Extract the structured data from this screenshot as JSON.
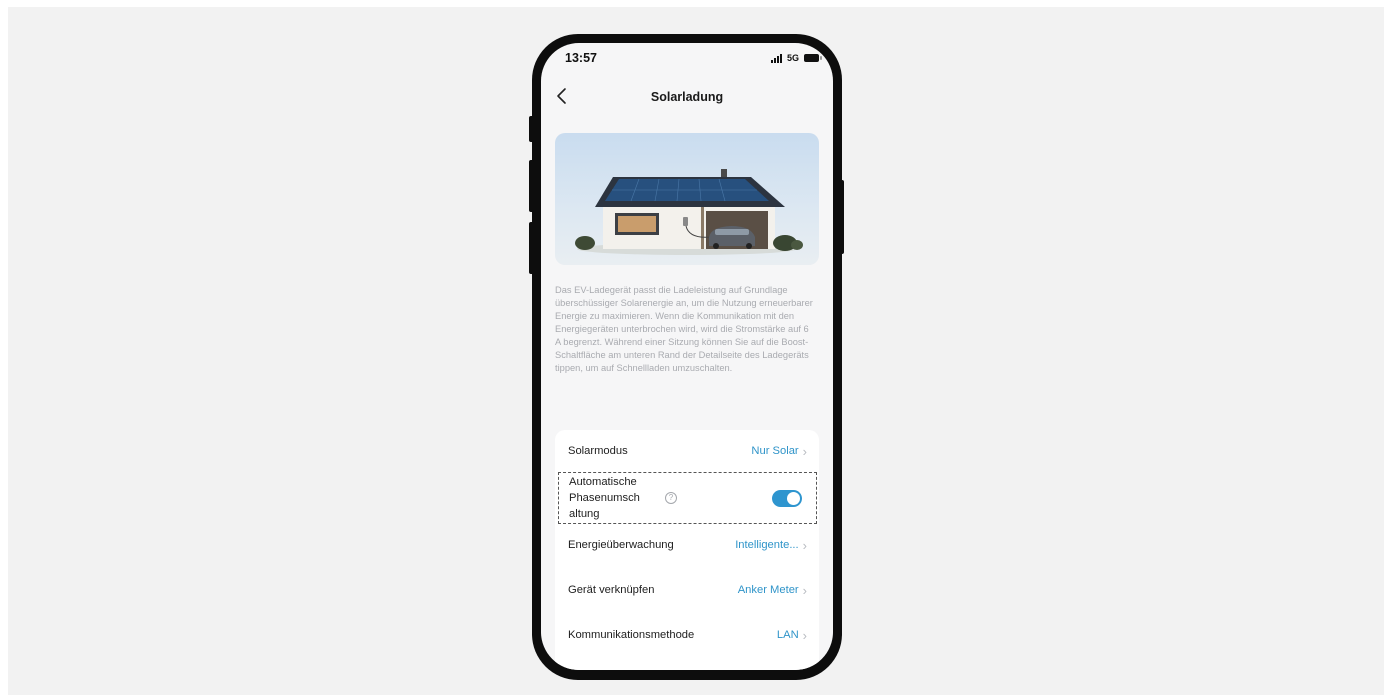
{
  "status_bar": {
    "time": "13:57",
    "network": "5G",
    "icons": [
      "signal-icon",
      "battery-icon"
    ]
  },
  "header": {
    "title": "Solarladung",
    "back_icon": "chevron-left-icon"
  },
  "hero_image": "house-with-solar-panels-and-ev-charger",
  "description": "Das EV-Ladegerät passt die Ladeleistung auf Grundlage überschüssiger Solarenergie an, um die Nutzung erneuerbarer Energie zu maximieren. Wenn die Kommunikation mit den Energiegeräten unterbrochen wird, wird die Stromstärke auf 6 A begrenzt. Während einer Sitzung können Sie auf die Boost-Schaltfläche am unteren Rand der Detailseite des Ladegeräts tippen, um auf Schnellladen umzuschalten.",
  "settings": {
    "solar_mode": {
      "label": "Solarmodus",
      "value": "Nur Solar"
    },
    "phase_switch": {
      "label_lines": [
        "Automatische",
        "Phasenumsch",
        "altung"
      ],
      "help_icon": "question-circle-icon",
      "enabled": true
    },
    "energy_monitoring": {
      "label": "Energieüberwachung",
      "value": "Intelligente..."
    },
    "link_device": {
      "label": "Gerät verknüpfen",
      "value": "Anker Meter"
    },
    "communication": {
      "label": "Kommunikationsmethode",
      "value": "LAN"
    }
  },
  "colors": {
    "accent": "#2e95cf",
    "value_text": "#2f94c9",
    "background": "#f6f6f7",
    "frame": "#0d0d0d"
  }
}
